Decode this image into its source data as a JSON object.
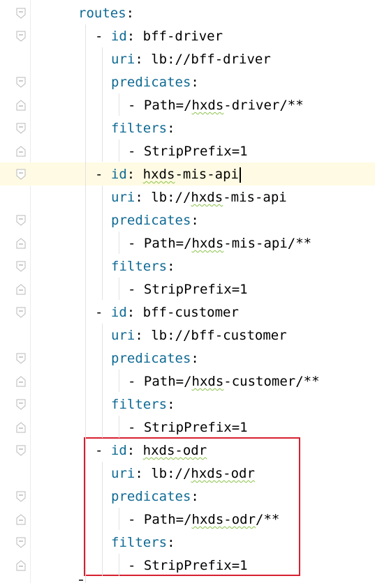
{
  "editor": {
    "language": "yaml",
    "colors": {
      "key": "#0f6a94",
      "value": "#000000",
      "current_line": "#fffae3",
      "highlight_box": "#d7202f",
      "spell_squiggle": "#8bc34a"
    },
    "lines": [
      {
        "indent": 0,
        "key": "routes",
        "sep": ":",
        "value": ""
      },
      {
        "indent": 1,
        "dash": "- ",
        "key": "id",
        "sep": ": ",
        "value": "bff-driver"
      },
      {
        "indent": 2,
        "key": "uri",
        "sep": ": ",
        "value": "lb://bff-driver"
      },
      {
        "indent": 2,
        "key": "predicates",
        "sep": ":",
        "value": ""
      },
      {
        "indent": 3,
        "dash": "- ",
        "value": "Path=/hxds-driver/**"
      },
      {
        "indent": 2,
        "key": "filters",
        "sep": ":",
        "value": ""
      },
      {
        "indent": 3,
        "dash": "- ",
        "value": "StripPrefix=1"
      },
      {
        "indent": 1,
        "dash": "- ",
        "key": "id",
        "sep": ": ",
        "value": "hxds-mis-api"
      },
      {
        "indent": 2,
        "key": "uri",
        "sep": ": ",
        "value": "lb://hxds-mis-api"
      },
      {
        "indent": 2,
        "key": "predicates",
        "sep": ":",
        "value": ""
      },
      {
        "indent": 3,
        "dash": "- ",
        "value": "Path=/hxds-mis-api/**"
      },
      {
        "indent": 2,
        "key": "filters",
        "sep": ":",
        "value": ""
      },
      {
        "indent": 3,
        "dash": "- ",
        "value": "StripPrefix=1"
      },
      {
        "indent": 1,
        "dash": "- ",
        "key": "id",
        "sep": ": ",
        "value": "bff-customer"
      },
      {
        "indent": 2,
        "key": "uri",
        "sep": ": ",
        "value": "lb://bff-customer"
      },
      {
        "indent": 2,
        "key": "predicates",
        "sep": ":",
        "value": ""
      },
      {
        "indent": 3,
        "dash": "- ",
        "value": "Path=/hxds-customer/**"
      },
      {
        "indent": 2,
        "key": "filters",
        "sep": ":",
        "value": ""
      },
      {
        "indent": 3,
        "dash": "- ",
        "value": "StripPrefix=1"
      },
      {
        "indent": 1,
        "dash": "- ",
        "key": "id",
        "sep": ": ",
        "value": "hxds-odr"
      },
      {
        "indent": 2,
        "key": "uri",
        "sep": ": ",
        "value": "lb://hxds-odr"
      },
      {
        "indent": 2,
        "key": "predicates",
        "sep": ":",
        "value": ""
      },
      {
        "indent": 3,
        "dash": "- ",
        "value": "Path=/hxds-odr/**"
      },
      {
        "indent": 2,
        "key": "filters",
        "sep": ":",
        "value": ""
      },
      {
        "indent": 3,
        "dash": "- ",
        "value": "StripPrefix=1"
      }
    ]
  }
}
